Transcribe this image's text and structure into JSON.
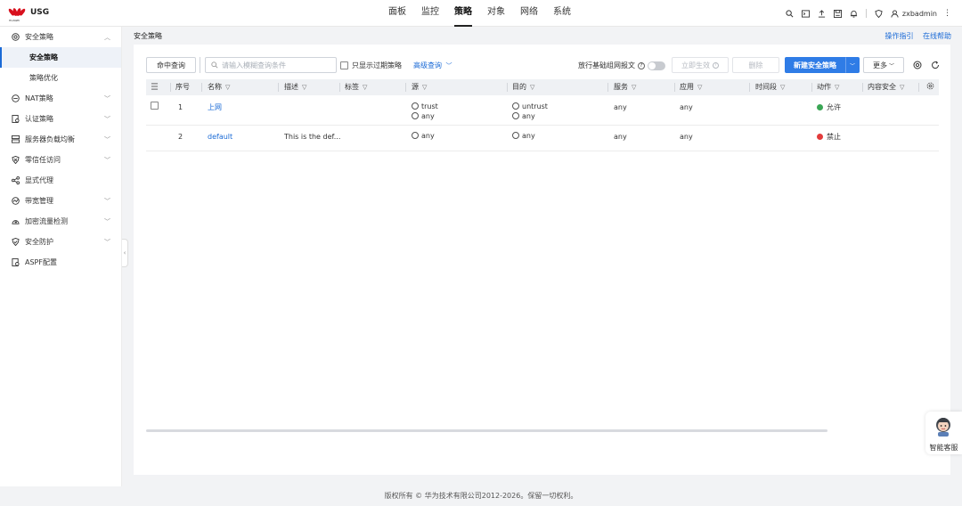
{
  "app": {
    "brand": "USG",
    "logo_text": "HUAWEI"
  },
  "nav": {
    "items": [
      "面板",
      "监控",
      "策略",
      "对象",
      "网络",
      "系统"
    ],
    "active": "策略"
  },
  "header_user": "zxbadmin",
  "sidebar": {
    "sections": [
      {
        "label": "安全策略",
        "icon": "shield-policy-icon",
        "expanded": true,
        "children": [
          "安全策略",
          "策略优化"
        ],
        "active_child": "安全策略"
      },
      {
        "label": "NAT策略",
        "icon": "nat-icon"
      },
      {
        "label": "认证策略",
        "icon": "auth-icon"
      },
      {
        "label": "服务器负载均衡",
        "icon": "server-icon"
      },
      {
        "label": "零信任访问",
        "icon": "zero-trust-icon"
      },
      {
        "label": "显式代理",
        "icon": "proxy-icon"
      },
      {
        "label": "带宽管理",
        "icon": "bandwidth-icon"
      },
      {
        "label": "加密流量检测",
        "icon": "encrypt-icon"
      },
      {
        "label": "安全防护",
        "icon": "protect-icon"
      },
      {
        "label": "ASPF配置",
        "icon": "aspf-icon"
      }
    ]
  },
  "breadcrumb": "安全策略",
  "help": {
    "guide": "操作指引",
    "online": "在线帮助"
  },
  "toolbar": {
    "hit_query": "命中查询",
    "search_placeholder": "请输入模糊查询条件",
    "only_expired": "只显示过期策略",
    "advanced": "高级查询",
    "allow_basic": "放行基础组网报文",
    "apply_now": "立即生效",
    "delete": "删除",
    "new_policy": "新建安全策略",
    "more": "更多"
  },
  "table": {
    "columns": [
      "序号",
      "名称",
      "描述",
      "标签",
      "源",
      "目的",
      "服务",
      "应用",
      "时间段",
      "动作",
      "内容安全"
    ],
    "rows": [
      {
        "seq": "1",
        "name": "上网",
        "desc": "",
        "tag": "",
        "src": [
          "trust",
          "any"
        ],
        "dst": [
          "untrust",
          "any"
        ],
        "service": "any",
        "app": "any",
        "time": "",
        "action": "允许",
        "action_color": "#3aa655",
        "content": ""
      },
      {
        "seq": "2",
        "name": "default",
        "desc": "This is the def...",
        "tag": "",
        "src": [
          "any"
        ],
        "dst": [
          "any"
        ],
        "service": "any",
        "app": "any",
        "time": "",
        "action": "禁止",
        "action_color": "#e23b3b",
        "content": ""
      }
    ]
  },
  "footer": "版权所有 © 华为技术有限公司2012-2026。保留一切权利。",
  "assistant_label": "智能客服"
}
